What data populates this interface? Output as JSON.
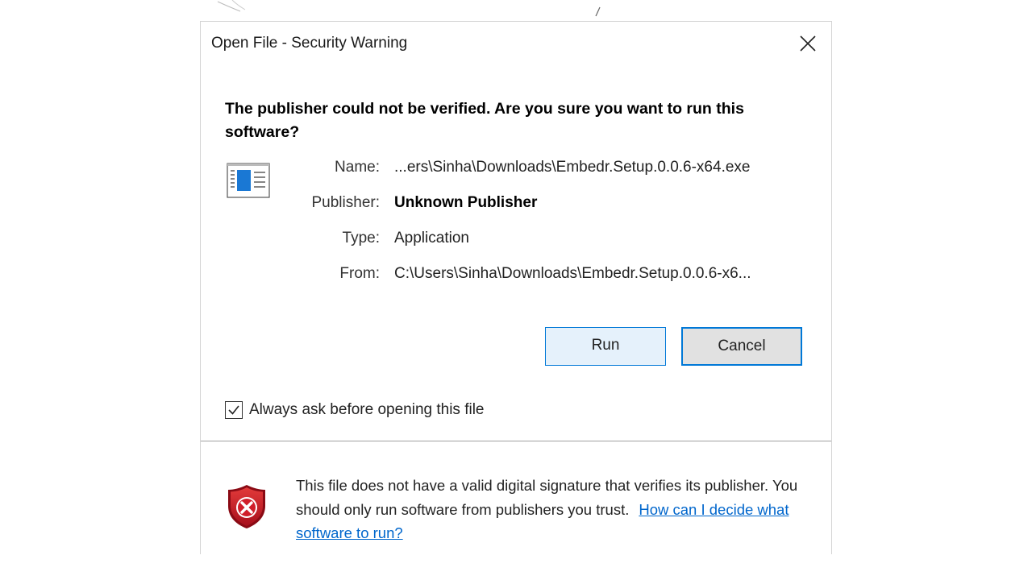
{
  "window": {
    "title": "Open File - Security Warning"
  },
  "dialog": {
    "heading": "The publisher could not be verified.  Are you sure you want to run this software?",
    "icon": "application-window-icon",
    "fields": [
      {
        "label": "Name:",
        "value": "...ers\\Sinha\\Downloads\\Embedr.Setup.0.0.6-x64.exe",
        "bold": false
      },
      {
        "label": "Publisher:",
        "value": "Unknown Publisher",
        "bold": true
      },
      {
        "label": "Type:",
        "value": "Application",
        "bold": false
      },
      {
        "label": "From:",
        "value": "C:\\Users\\Sinha\\Downloads\\Embedr.Setup.0.0.6-x6...",
        "bold": false
      }
    ],
    "buttons": {
      "run_label": "Run",
      "cancel_label": "Cancel"
    },
    "checkbox": {
      "label": "Always ask before opening this file",
      "checked": true
    }
  },
  "footer": {
    "icon": "red-shield-x-icon",
    "text": "This file does not have a valid digital signature that verifies its publisher.  You should only run software from publishers you trust.",
    "link_text": "How can I decide what software to run?"
  },
  "colors": {
    "accent": "#0078d7",
    "link": "#0066cc",
    "shield": "#c8102e"
  }
}
